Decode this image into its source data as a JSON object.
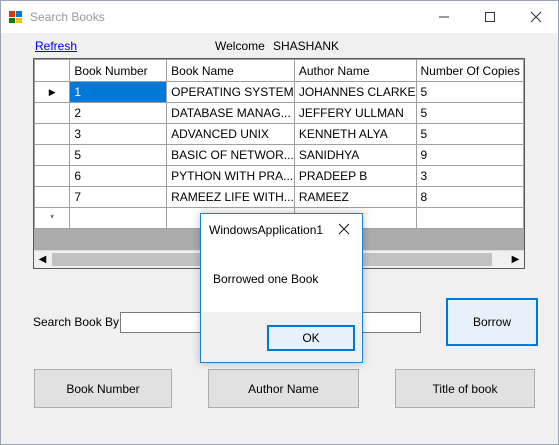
{
  "window": {
    "title": "Search Books"
  },
  "header": {
    "refresh_label": "Refresh",
    "welcome_label": "Welcome",
    "username": "SHASHANK"
  },
  "grid": {
    "columns": [
      "Book Number",
      "Book Name",
      "Author Name",
      "Number Of Copies"
    ],
    "rows": [
      [
        "1",
        "OPERATING SYSTEM",
        "JOHANNES CLARKE",
        "5"
      ],
      [
        "2",
        "DATABASE MANAG...",
        "JEFFERY ULLMAN",
        "5"
      ],
      [
        "3",
        "ADVANCED UNIX",
        "KENNETH ALYA",
        "5"
      ],
      [
        "5",
        "BASIC OF NETWOR...",
        "SANIDHYA",
        "9"
      ],
      [
        "6",
        "PYTHON WITH PRA...",
        "PRADEEP B",
        "3"
      ],
      [
        "7",
        "RAMEEZ LIFE WITH...",
        "RAMEEZ",
        "8"
      ]
    ],
    "current_row_marker": "▶",
    "new_row_marker": "*",
    "selected_row": 0
  },
  "search": {
    "label": "Search Book By",
    "value": "",
    "placeholder": ""
  },
  "buttons": {
    "borrow": "Borrow",
    "book_number": "Book Number",
    "author_name": "Author Name",
    "title_of_book": "Title of book"
  },
  "dialog": {
    "title": "WindowsApplication1",
    "message": "Borrowed one Book",
    "ok_label": "OK"
  },
  "colors": {
    "accent": "#0078d7",
    "link": "#0000ee",
    "selection": "#0078d7"
  }
}
